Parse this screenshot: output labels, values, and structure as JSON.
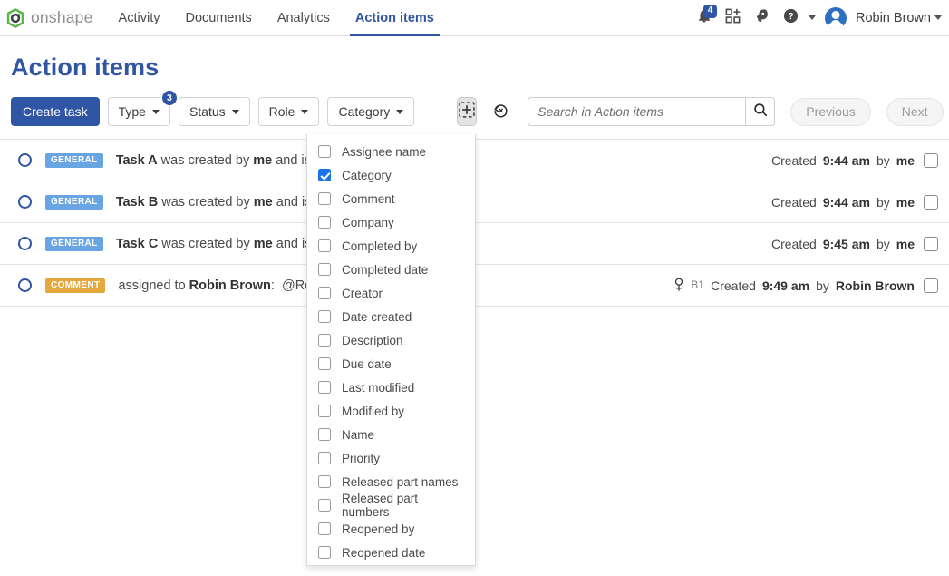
{
  "nav": {
    "brand": "onshape",
    "brand_logo_icon": "onshape-logo-icon",
    "tabs": [
      {
        "label": "Activity",
        "active": false
      },
      {
        "label": "Documents",
        "active": false
      },
      {
        "label": "Analytics",
        "active": false
      },
      {
        "label": "Action items",
        "active": true
      }
    ],
    "right": {
      "notifications_icon": "bell-icon",
      "notifications_count": "4",
      "apps_icon": "app-grid-add-icon",
      "learning_icon": "learning-center-icon",
      "help_icon": "help-question-icon",
      "help_caret_icon": "chevron-down-icon",
      "avatar_icon": "user-avatar",
      "user_name": "Robin Brown",
      "user_caret_icon": "chevron-down-icon"
    }
  },
  "page": {
    "title": "Action items",
    "title_color": "#2f55a4"
  },
  "toolbar": {
    "create_task_label": "Create task",
    "filters": [
      {
        "label": "Type",
        "badge": "3"
      },
      {
        "label": "Status",
        "badge": ""
      },
      {
        "label": "Role",
        "badge": ""
      },
      {
        "label": "Category",
        "badge": ""
      }
    ],
    "column_picker_icon": "add-column-icon",
    "reset_icon": "reset-history-icon",
    "search": {
      "value": "",
      "placeholder": "Search in Action items",
      "search_icon": "search-icon"
    },
    "previous_label": "Previous",
    "next_label": "Next",
    "sort_icon": "sort-descending-icon"
  },
  "dropdown": {
    "items": [
      {
        "label": "Assignee name",
        "checked": false
      },
      {
        "label": "Category",
        "checked": true
      },
      {
        "label": "Comment",
        "checked": false
      },
      {
        "label": "Company",
        "checked": false
      },
      {
        "label": "Completed by",
        "checked": false
      },
      {
        "label": "Completed date",
        "checked": false
      },
      {
        "label": "Creator",
        "checked": false
      },
      {
        "label": "Date created",
        "checked": false
      },
      {
        "label": "Description",
        "checked": false
      },
      {
        "label": "Due date",
        "checked": false
      },
      {
        "label": "Last modified",
        "checked": false
      },
      {
        "label": "Modified by",
        "checked": false
      },
      {
        "label": "Name",
        "checked": false
      },
      {
        "label": "Priority",
        "checked": false
      },
      {
        "label": "Released part names",
        "checked": false
      },
      {
        "label": "Released part numbers",
        "checked": false
      },
      {
        "label": "Reopened by",
        "checked": false
      },
      {
        "label": "Reopened date",
        "checked": false
      }
    ]
  },
  "rows": [
    {
      "status_icon": "open-circle-icon",
      "badge": "GENERAL",
      "badge_kind": "general",
      "text_html": "<b>Task A</b> was created by <b>me</b> and is as",
      "pin": "",
      "created_label": "Created",
      "time": "9:44 am",
      "by_label": "by",
      "author": "me",
      "checked": false
    },
    {
      "status_icon": "open-circle-icon",
      "badge": "GENERAL",
      "badge_kind": "general",
      "text_html": "<b>Task B</b> was created by <b>me</b> and is as",
      "pin": "",
      "created_label": "Created",
      "time": "9:44 am",
      "by_label": "by",
      "author": "me",
      "checked": false
    },
    {
      "status_icon": "open-circle-icon",
      "badge": "GENERAL",
      "badge_kind": "general",
      "text_html": "<b>Task C</b> was created by <b>me</b> and is as",
      "pin": "",
      "created_label": "Created",
      "time": "9:45 am",
      "by_label": "by",
      "author": "me",
      "checked": false
    },
    {
      "status_icon": "open-circle-icon",
      "badge": "COMMENT",
      "badge_kind": "comment",
      "text_html": "assigned to <b>Robin Brown</b>:&nbsp; @Robin",
      "pin": "B1",
      "created_label": "Created",
      "time": "9:49 am",
      "by_label": "by",
      "author": "Robin Brown",
      "checked": false
    }
  ]
}
